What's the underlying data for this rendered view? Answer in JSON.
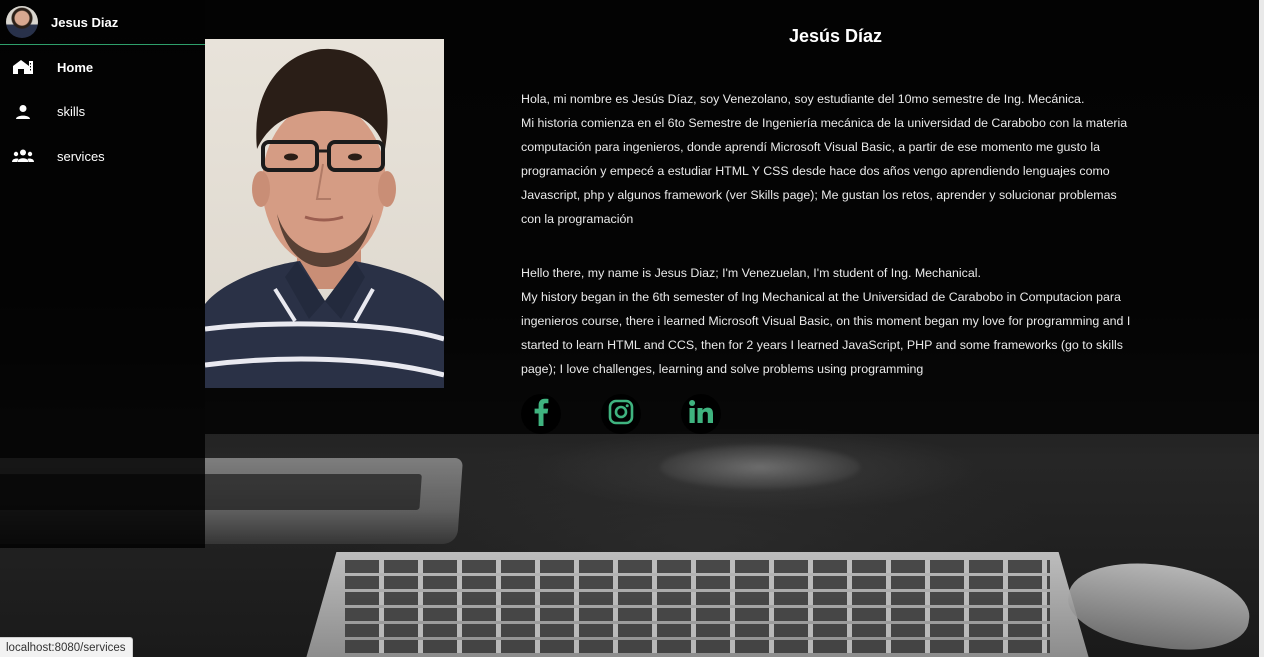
{
  "sidebar": {
    "user_name": "Jesus Diaz",
    "items": [
      {
        "label": "Home",
        "icon": "home-icon"
      },
      {
        "label": "skills",
        "icon": "person-icon"
      },
      {
        "label": "services",
        "icon": "group-icon"
      }
    ]
  },
  "main": {
    "title": "Jesús Díaz",
    "spanish_lines": [
      "Hola, mi nombre es Jesús Díaz, soy Venezolano, soy estudiante del 10mo semestre de Ing. Mecánica.",
      "Mi historia comienza en el 6to Semestre de Ingeniería mecánica de la universidad de Carabobo con la materia",
      "computación para ingenieros, donde aprendí Microsoft Visual Basic, a partir de ese momento me gusto la",
      "programación y empecé a estudiar HTML Y CSS desde hace dos años vengo aprendiendo lenguajes como",
      "Javascript, php y algunos framework (ver Skills page); Me gustan los retos, aprender y solucionar problemas",
      "con la programación"
    ],
    "english_lines": [
      "Hello there, my name is Jesus Diaz; I'm Venezuelan, I'm student of Ing. Mechanical.",
      "My history began in the 6th semester of Ing Mechanical at the Universidad de Carabobo in Computacion para",
      "ingenieros course, there i learned Microsoft Visual Basic, on this moment began my love for programming and I",
      "started to learn HTML and CCS, then for 2 years I learned JavaScript, PHP and some frameworks (go to skills",
      "page); I love challenges, learning and solve problems using programming"
    ],
    "social": [
      {
        "icon": "facebook-icon"
      },
      {
        "icon": "instagram-icon"
      },
      {
        "icon": "linkedin-icon"
      }
    ]
  },
  "statusbar": {
    "url": "localhost:8080/services"
  },
  "colors": {
    "accent": "#2e9e6a",
    "social_green": "#3fb37f"
  }
}
